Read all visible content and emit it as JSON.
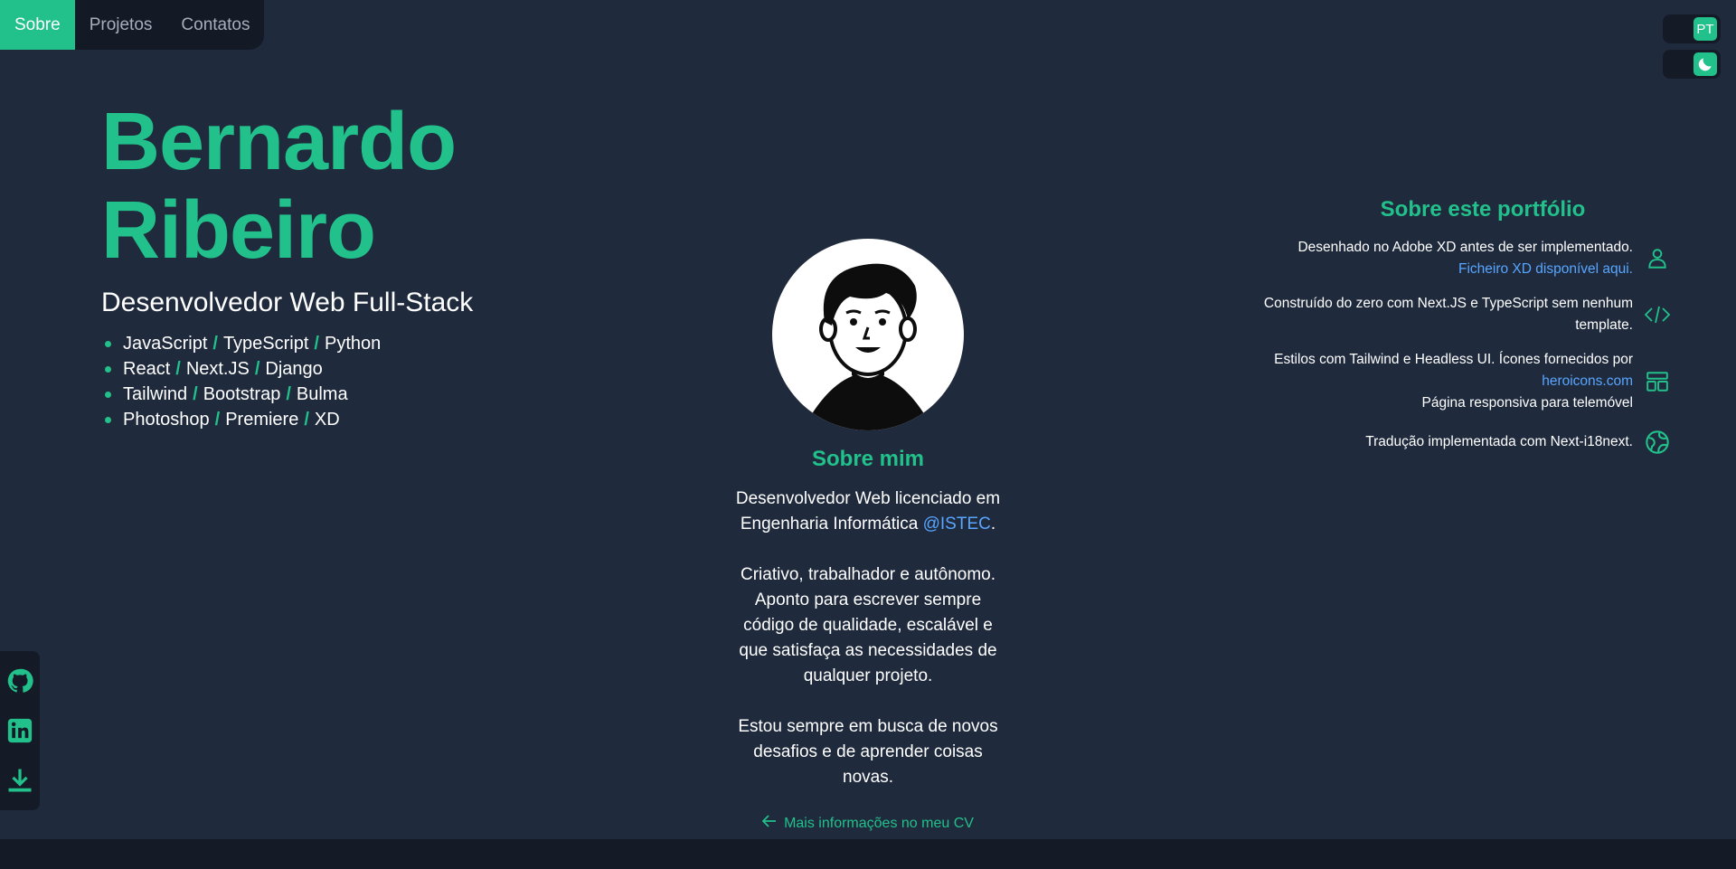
{
  "nav": {
    "items": [
      {
        "label": "Sobre",
        "active": true
      },
      {
        "label": "Projetos",
        "active": false
      },
      {
        "label": "Contatos",
        "active": false
      }
    ]
  },
  "toggles": {
    "language": "PT",
    "theme_icon": "moon-icon"
  },
  "hero": {
    "first_name": "Bernardo",
    "last_name": "Ribeiro",
    "role": "Desenvolvedor Web Full-Stack",
    "skills": [
      [
        "JavaScript",
        "TypeScript",
        "Python"
      ],
      [
        "React",
        "Next.JS",
        "Django"
      ],
      [
        "Tailwind",
        "Bootstrap",
        "Bulma"
      ],
      [
        "Photoshop",
        "Premiere",
        "XD"
      ]
    ],
    "separator": "/"
  },
  "about": {
    "title": "Sobre mim",
    "p1_prefix": "Desenvolvedor Web licenciado em Engenharia Informática ",
    "p1_link": "@ISTEC",
    "p1_suffix": ".",
    "p2": "Criativo, trabalhador e autônomo. Aponto para escrever sempre código de qualidade, escalável e que satisfaça as necessidades de qualquer projeto.",
    "p3": "Estou sempre em busca de novos desafios e de aprender coisas novas.",
    "cv_link": "Mais informações no meu CV"
  },
  "portfolio": {
    "title": "Sobre este portfólio",
    "f1_text": "Desenhado no Adobe XD antes de ser implementado.",
    "f1_link": "Ficheiro XD disponível aqui.",
    "f2_text": "Construído do zero com Next.JS e TypeScript sem nenhum template.",
    "f3_text": "Estilos com Tailwind e Headless UI. Ícones fornecidos por",
    "f3_link": "heroicons.com",
    "f3_text2": "Página responsiva para telemóvel",
    "f4_text": "Tradução implementada com Next-i18next."
  },
  "colors": {
    "accent": "#22c08a",
    "background": "#1f2a3d",
    "panel": "#141b27",
    "link": "#58a6ff"
  },
  "social": [
    "github-icon",
    "linkedin-icon",
    "download-icon"
  ]
}
